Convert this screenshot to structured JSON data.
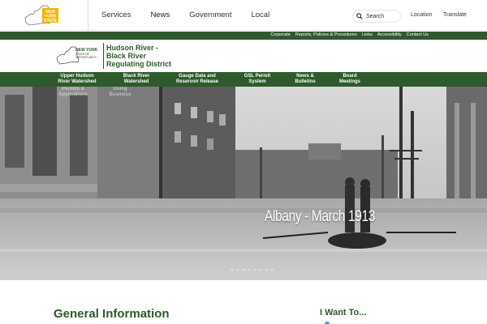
{
  "global_nav": {
    "logo_text": [
      "NEW",
      "YORK",
      "STATE"
    ],
    "items": [
      {
        "label": "Services"
      },
      {
        "label": "News"
      },
      {
        "label": "Government"
      },
      {
        "label": "Local"
      }
    ],
    "search_placeholder": "Search",
    "location_label": "Location",
    "translate_label": "Translate"
  },
  "util_links": [
    "Corporate",
    "Reports, Policies & Procedures",
    "Links",
    "Accessibility",
    "Contact Us"
  ],
  "agency": {
    "logo_text": [
      "NEW YORK",
      "STATE OF",
      "OPPORTUNITY."
    ],
    "name_lines": [
      "Hudson River -",
      "Black River",
      "Regulating District"
    ]
  },
  "agency_nav": [
    {
      "label1": "Upper Hudson",
      "label2": "River Watershed"
    },
    {
      "label1": "Black River",
      "label2": "Watershed"
    },
    {
      "label1": "Gauge Data and",
      "label2": "Reservoir Release"
    },
    {
      "label1": "GSL Permit",
      "label2": "System"
    },
    {
      "label1": "News &",
      "label2": "Bulletins"
    },
    {
      "label1": "Board",
      "label2": "Meetings"
    }
  ],
  "hero": {
    "caption": "Albany - March 1913",
    "ghost1": [
      "Permits &",
      "Applications"
    ],
    "ghost2": [
      "Doing",
      "Business"
    ]
  },
  "content": {
    "general_heading": "General Information",
    "iwant_heading": "I Want To..."
  },
  "colors": {
    "brand_green": "#2e5a2c",
    "state_yellow": "#f0b400"
  }
}
